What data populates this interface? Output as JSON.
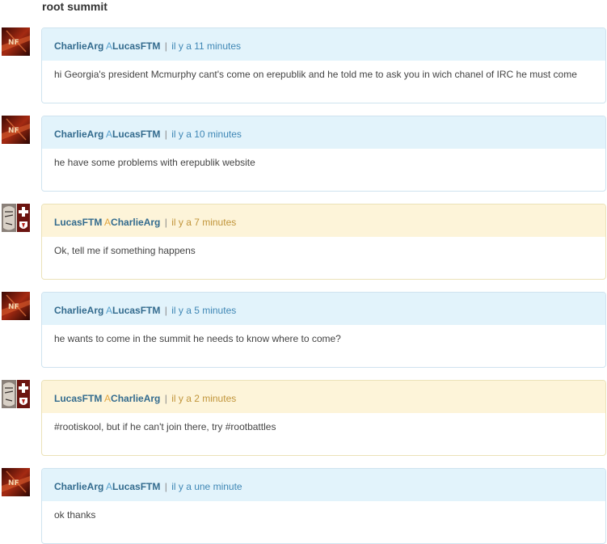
{
  "conversation": {
    "subject": "root summit"
  },
  "messages": [
    {
      "sender": "CharlieArg",
      "direction_marker": "A",
      "recipient": "LucasFTM",
      "separator": "|",
      "time": "il y a 11 minutes",
      "text": "hi Georgia's president Mcmurphy cant's come on erepublik and he told me to ask you in wich chanel of IRC he must come",
      "style": "incoming",
      "avatar": "charliearg-avatar"
    },
    {
      "sender": "CharlieArg",
      "direction_marker": "A",
      "recipient": "LucasFTM",
      "separator": "|",
      "time": "il y a 10 minutes",
      "text": "he have some problems with erepublik website",
      "style": "incoming",
      "avatar": "charliearg-avatar"
    },
    {
      "sender": "LucasFTM",
      "direction_marker": "A",
      "recipient": "CharlieArg",
      "separator": "|",
      "time": "il y a 7 minutes",
      "text": "Ok, tell me if something happens",
      "style": "outgoing",
      "avatar": "lucasftm-avatar"
    },
    {
      "sender": "CharlieArg",
      "direction_marker": "A",
      "recipient": "LucasFTM",
      "separator": "|",
      "time": "il y a 5 minutes",
      "text": "he wants to come in the summit he needs to know where to come?",
      "style": "incoming",
      "avatar": "charliearg-avatar"
    },
    {
      "sender": "LucasFTM",
      "direction_marker": "A",
      "recipient": "CharlieArg",
      "separator": "|",
      "time": "il y a 2 minutes",
      "text": "#rootiskool, but if he can't join there, try #rootbattles",
      "style": "outgoing",
      "avatar": "lucasftm-avatar"
    },
    {
      "sender": "CharlieArg",
      "direction_marker": "A",
      "recipient": "LucasFTM",
      "separator": "|",
      "time": "il y a une minute",
      "text": "ok thanks",
      "style": "incoming",
      "avatar": "charliearg-avatar"
    }
  ],
  "colors": {
    "incoming_header": "#e2f3fb",
    "incoming_border": "#cfe3ef",
    "outgoing_header": "#fdf4d9",
    "outgoing_border": "#ebe2b8",
    "name_link": "#336b8e"
  }
}
